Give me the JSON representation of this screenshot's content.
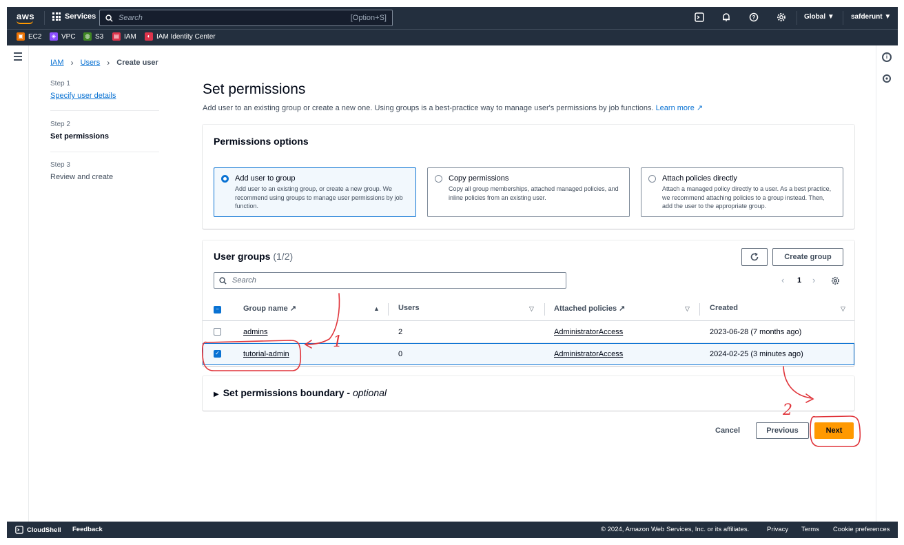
{
  "topnav": {
    "logo": "aws",
    "services_label": "Services",
    "search_placeholder": "Search",
    "search_shortcut": "[Option+S]",
    "region": "Global ▼",
    "user": "safderunt ▼"
  },
  "favorites": [
    {
      "label": "EC2",
      "color": "#ed7100"
    },
    {
      "label": "VPC",
      "color": "#8c4fff"
    },
    {
      "label": "S3",
      "color": "#3f8624"
    },
    {
      "label": "IAM",
      "color": "#dd344c"
    },
    {
      "label": "IAM Identity Center",
      "color": "#dd344c"
    }
  ],
  "breadcrumb": {
    "iam": "IAM",
    "users": "Users",
    "current": "Create user"
  },
  "steps": [
    {
      "number": "Step 1",
      "label": "Specify user details"
    },
    {
      "number": "Step 2",
      "label": "Set permissions"
    },
    {
      "number": "Step 3",
      "label": "Review and create"
    }
  ],
  "page": {
    "title": "Set permissions",
    "description": "Add user to an existing group or create a new one. Using groups is a best-practice way to manage user's permissions by job functions.",
    "learn_more": "Learn more"
  },
  "permissions_options": {
    "heading": "Permissions options",
    "options": [
      {
        "title": "Add user to group",
        "desc": "Add user to an existing group, or create a new group. We recommend using groups to manage user permissions by job function.",
        "selected": true
      },
      {
        "title": "Copy permissions",
        "desc": "Copy all group memberships, attached managed policies, and inline policies from an existing user.",
        "selected": false
      },
      {
        "title": "Attach policies directly",
        "desc": "Attach a managed policy directly to a user. As a best practice, we recommend attaching policies to a group instead. Then, add the user to the appropriate group.",
        "selected": false
      }
    ]
  },
  "user_groups": {
    "heading": "User groups",
    "count": "(1/2)",
    "create_group": "Create group",
    "search_placeholder": "Search",
    "page": "1",
    "columns": [
      "Group name",
      "Users",
      "Attached policies",
      "Created"
    ],
    "rows": [
      {
        "name": "admins",
        "users": "2",
        "policy": "AdministratorAccess",
        "created": "2023-06-28 (7 months ago)",
        "checked": false
      },
      {
        "name": "tutorial-admin",
        "users": "0",
        "policy": "AdministratorAccess",
        "created": "2024-02-25 (3 minutes ago)",
        "checked": true
      }
    ]
  },
  "boundary": {
    "label": "Set permissions boundary - ",
    "optional": "optional"
  },
  "actions": {
    "cancel": "Cancel",
    "previous": "Previous",
    "next": "Next"
  },
  "annotations": {
    "one": "1",
    "two": "2",
    "color": "#e0343a"
  },
  "footer": {
    "cloudshell": "CloudShell",
    "feedback": "Feedback",
    "copyright": "© 2024, Amazon Web Services, Inc. or its affiliates.",
    "privacy": "Privacy",
    "terms": "Terms",
    "cookies": "Cookie preferences"
  },
  "colors": {
    "accent": "#0972d3",
    "primary_button": "#ff9900",
    "nav_bg": "#232f3e"
  }
}
